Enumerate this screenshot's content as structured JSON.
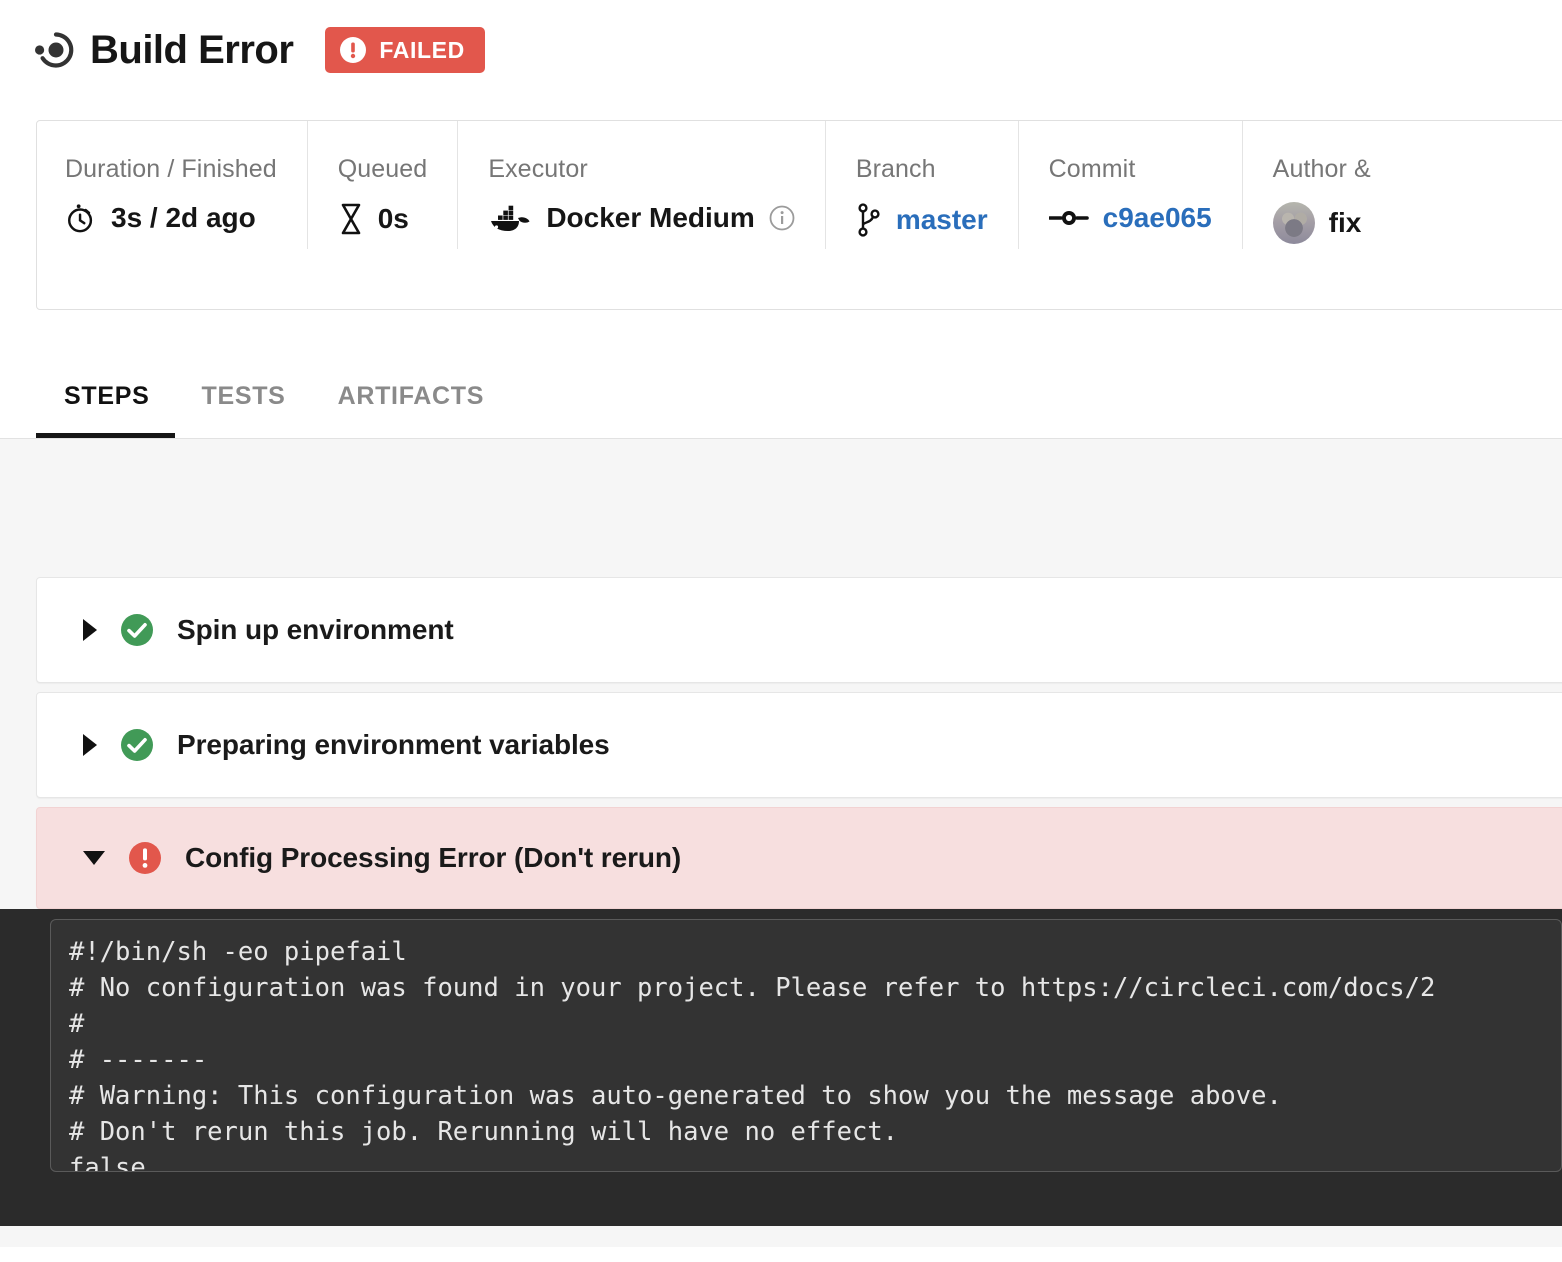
{
  "header": {
    "logo_icon": "circleci-logo-icon",
    "title": "Build Error",
    "status": {
      "icon": "error-exclamation-icon",
      "label": "FAILED",
      "color": "#e2574c"
    }
  },
  "meta": {
    "cells": [
      {
        "label": "Duration / Finished",
        "icon": "stopwatch-icon",
        "value": "3s / 2d ago",
        "link": false
      },
      {
        "label": "Queued",
        "icon": "hourglass-icon",
        "value": "0s",
        "link": false
      },
      {
        "label": "Executor",
        "icon": "docker-whale-icon",
        "value": "Docker Medium",
        "trailing_icon": "info-circle-icon",
        "link": false
      },
      {
        "label": "Branch",
        "icon": "git-branch-icon",
        "value": "master",
        "link": true
      },
      {
        "label": "Commit",
        "icon": "git-commit-icon",
        "value": "c9ae065",
        "link": true
      },
      {
        "label": "Author &",
        "icon": "avatar",
        "value": "fix",
        "link": false
      }
    ]
  },
  "tabs": [
    {
      "label": "STEPS",
      "active": true
    },
    {
      "label": "TESTS",
      "active": false
    },
    {
      "label": "ARTIFACTS",
      "active": false
    }
  ],
  "steps": [
    {
      "title": "Spin up environment",
      "status": "success",
      "status_icon": "check-circle-icon",
      "expanded": false,
      "caret_icon": "caret-right-icon"
    },
    {
      "title": "Preparing environment variables",
      "status": "success",
      "status_icon": "check-circle-icon",
      "expanded": false,
      "caret_icon": "caret-right-icon"
    },
    {
      "title": "Config Processing Error (Don't rerun)",
      "status": "error",
      "status_icon": "error-exclamation-icon",
      "expanded": true,
      "caret_icon": "caret-down-icon"
    }
  ],
  "console": {
    "lines": [
      "#!/bin/sh -eo pipefail",
      "# No configuration was found in your project. Please refer to https://circleci.com/docs/2",
      "#",
      "# -------",
      "# Warning: This configuration was auto-generated to show you the message above.",
      "# Don't rerun this job. Rerunning will have no effect.",
      "false"
    ]
  },
  "colors": {
    "success_green": "#419a57",
    "error_red": "#e2574c",
    "error_bg_pink": "#f7dfdf",
    "link_blue": "#2a6ebb",
    "console_bg": "#2b2b2b",
    "console_box": "#333333",
    "steps_bg": "#f6f6f6"
  }
}
